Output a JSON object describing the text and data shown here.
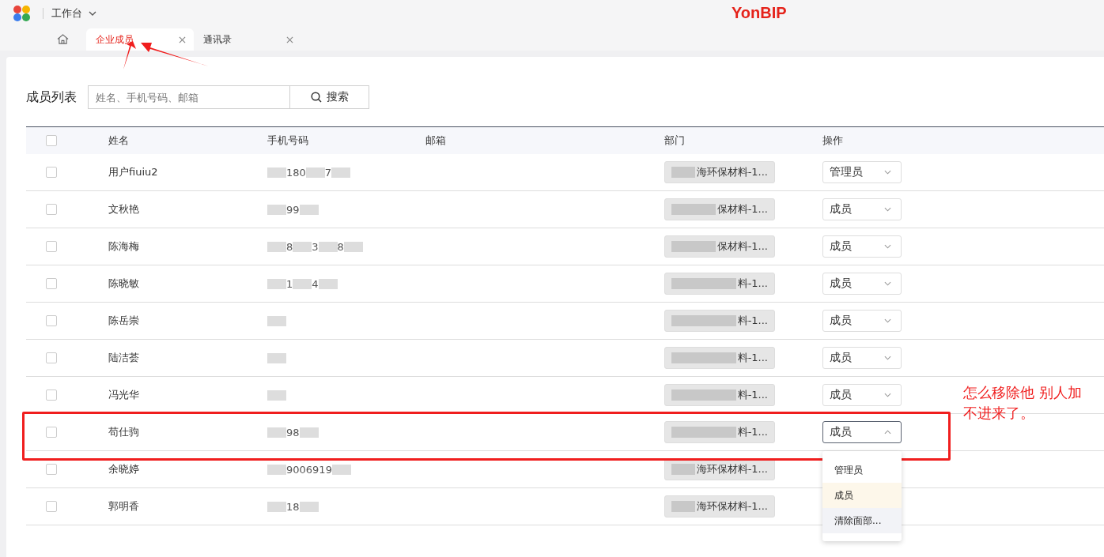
{
  "topbar": {
    "workspace": "工作台",
    "brand": "YonBIP"
  },
  "tabs": [
    {
      "label": "企业成员",
      "selected": true
    },
    {
      "label": "通讯录",
      "selected": false
    }
  ],
  "page": {
    "title": "成员列表",
    "search": {
      "placeholder": "姓名、手机号码、邮箱",
      "button": "搜索"
    }
  },
  "table": {
    "all_checked": false,
    "columns": [
      "姓名",
      "手机号码",
      "邮箱",
      "部门",
      "操作"
    ],
    "rows": [
      {
        "checked": false,
        "name": "用户fiuiu2",
        "phone_fragments": [
          "180",
          "7"
        ],
        "department": "海环保材料-1...",
        "role": "管理员",
        "open": false
      },
      {
        "checked": false,
        "name": "文秋艳",
        "phone_fragments": [
          "99"
        ],
        "department": "保材料-1...",
        "role": "成员",
        "open": false
      },
      {
        "checked": false,
        "name": "陈海梅",
        "phone_fragments": [
          "8",
          "3",
          "8"
        ],
        "department": "保材料-1...",
        "role": "成员",
        "open": false
      },
      {
        "checked": false,
        "name": "陈晓敏",
        "phone_fragments": [
          "1",
          "4"
        ],
        "department": "料-1...",
        "role": "成员",
        "open": false
      },
      {
        "checked": false,
        "name": "陈岳崇",
        "phone_fragments": [],
        "department": "料-1...",
        "role": "成员",
        "open": false
      },
      {
        "checked": false,
        "name": "陆洁荟",
        "phone_fragments": [],
        "department": "料-1...",
        "role": "成员",
        "open": false
      },
      {
        "checked": false,
        "name": "冯光华",
        "phone_fragments": [],
        "department": "料-1...",
        "role": "成员",
        "open": false
      },
      {
        "checked": false,
        "name": "苟仕驹",
        "phone_fragments": [
          "98"
        ],
        "department": "料-1...",
        "role": "成员",
        "open": true
      },
      {
        "checked": false,
        "name": "余晓婷",
        "phone_fragments": [
          "9006919"
        ],
        "department": "海环保材料-1..."
      },
      {
        "checked": false,
        "name": "郭明香",
        "phone_fragments": [
          "18"
        ],
        "department": "海环保材料-1..."
      }
    ]
  },
  "dropdown": {
    "options": [
      {
        "label": "管理员",
        "selected": false,
        "hovered": false
      },
      {
        "label": "成员",
        "selected": true,
        "hovered": false
      },
      {
        "label": "清除面部...",
        "selected": false,
        "hovered": true
      }
    ]
  },
  "annotation": {
    "note": "怎么移除他 别人加不进来了。"
  }
}
